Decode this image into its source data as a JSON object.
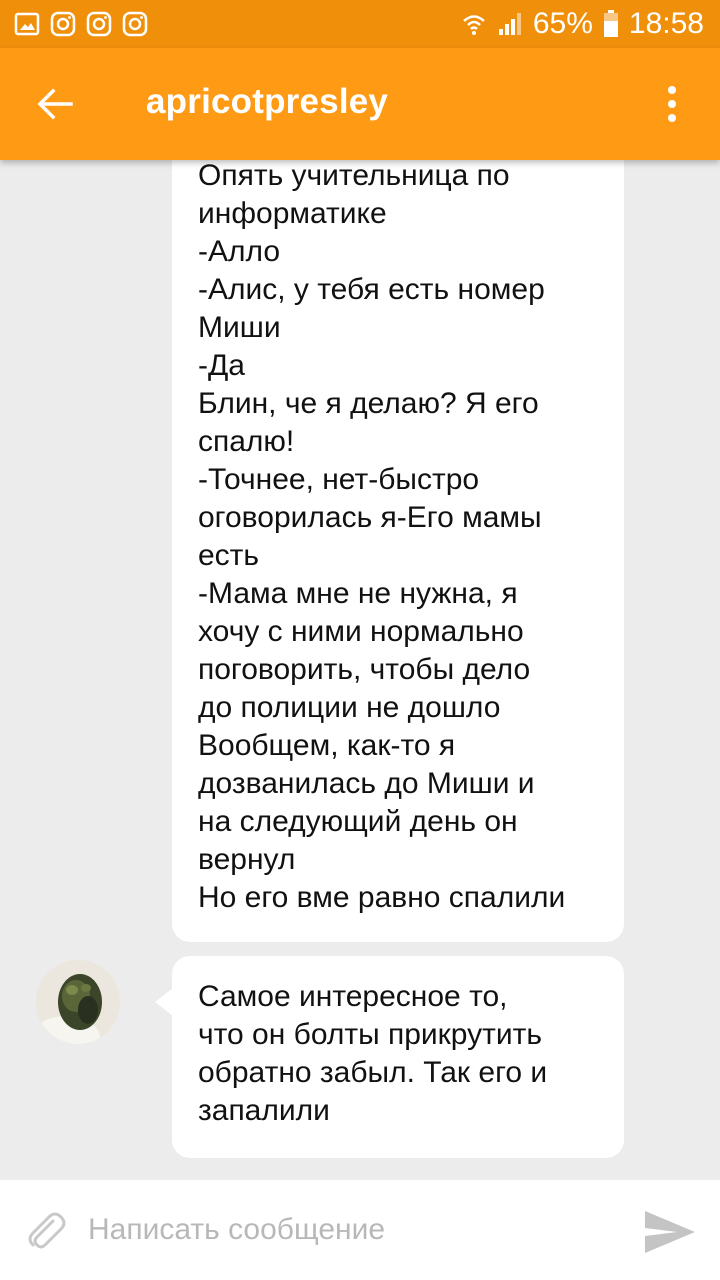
{
  "status_bar": {
    "battery": "65%",
    "time": "18:58",
    "icons": [
      "gallery-icon",
      "instagram-icon",
      "instagram-icon",
      "instagram-icon",
      "wifi-icon",
      "signal-icon",
      "battery-icon"
    ]
  },
  "app_bar": {
    "title": "apricotpresley",
    "back_icon": "arrow-left-icon",
    "menu_icon": "more-vert-icon"
  },
  "messages": [
    {
      "text": "Опять учительница по\nинформатике\n-Алло\n-Алис, у тебя есть номер\nМиши\n-Да\nБлин, че я делаю? Я его\nспалю!\n-Точнее, нет-быстро\nоговорилась я-Его мамы\nесть\n-Мама мне не нужна, я\nхочу с ними нормально\nпоговорить, чтобы дело\nдо полиции не дошло\nВообщем, как-то я\nдозванилась до Миши и\nна следующий день он\nвернул\nНо его вме равно спалили"
    },
    {
      "text": "Самое интересное то,\nчто он болты прикрутить\nобратно забыл. Так его и\nзапалили"
    }
  ],
  "composer": {
    "placeholder": "Написать сообщение",
    "attach_icon": "paperclip-icon",
    "send_icon": "send-icon"
  },
  "colors": {
    "status_bar": "#f08f0a",
    "app_bar": "#ff9a14",
    "chat_background": "#ececec",
    "bubble": "#ffffff"
  }
}
